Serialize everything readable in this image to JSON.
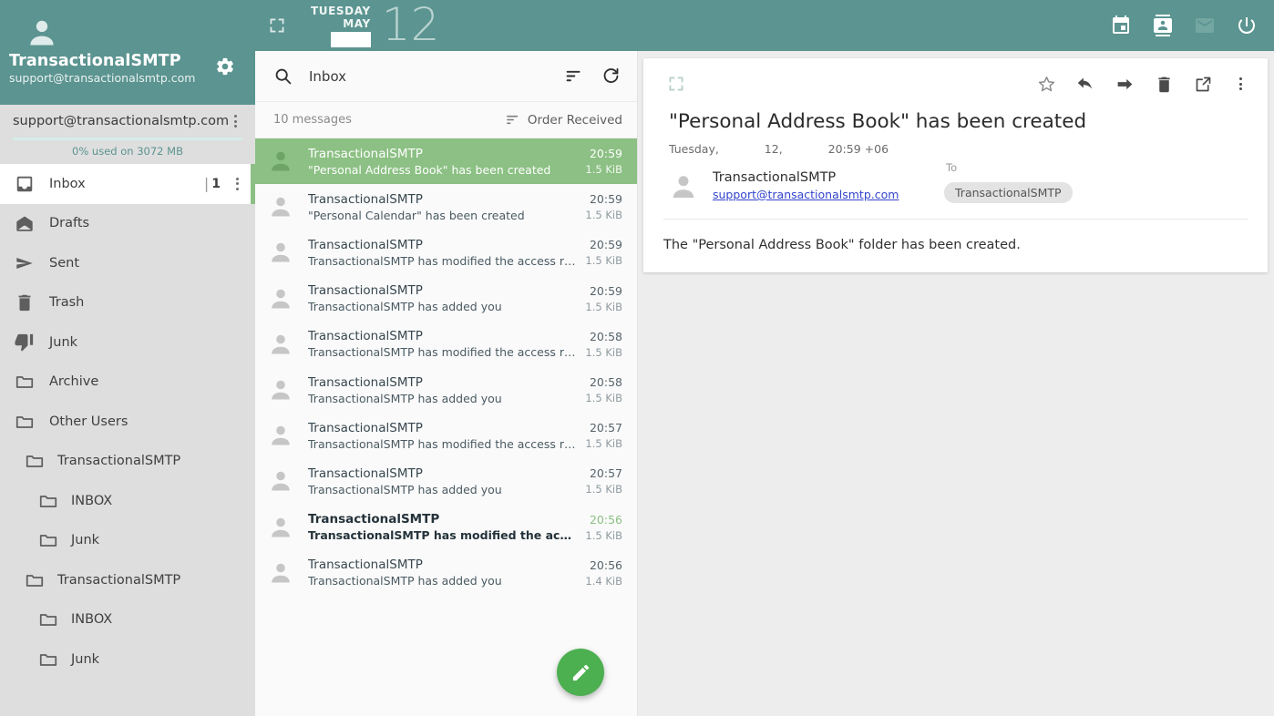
{
  "theme": {
    "teal": "#5b9490",
    "green_accent": "#8cbf84",
    "selected_row": "#8cc084",
    "fab_green": "#4caf50",
    "sidebar_bg": "#dedede",
    "list_bg": "#fafafa",
    "reader_bg": "#ededed"
  },
  "sidebar": {
    "avatar_icon": "person-icon",
    "display_name": "TransactionalSMTP",
    "email": "support@transactionalsmtp.com",
    "settings_icon": "gear-icon",
    "account": {
      "email": "support@transactionalsmtp.com",
      "menu_icon": "kebab-menu-icon",
      "quota_text": "0% used on 3072 MB",
      "quota_percent": 0
    },
    "folders": [
      {
        "label": "Inbox",
        "icon": "inbox-icon",
        "count": "1",
        "selected": true,
        "level": 0,
        "menu_icon": "kebab-menu-icon"
      },
      {
        "label": "Drafts",
        "icon": "draft-envelope-icon",
        "count": "",
        "selected": false,
        "level": 0
      },
      {
        "label": "Sent",
        "icon": "send-arrow-icon",
        "count": "",
        "selected": false,
        "level": 0
      },
      {
        "label": "Trash",
        "icon": "trash-icon",
        "count": "",
        "selected": false,
        "level": 0
      },
      {
        "label": "Junk",
        "icon": "thumb-down-icon",
        "count": "",
        "selected": false,
        "level": 0
      },
      {
        "label": "Archive",
        "icon": "folder-icon",
        "count": "",
        "selected": false,
        "level": 0
      },
      {
        "label": "Other Users",
        "icon": "folder-icon",
        "count": "",
        "selected": false,
        "level": 0
      },
      {
        "label": "TransactionalSMTP",
        "icon": "folder-icon",
        "count": "",
        "selected": false,
        "level": 1
      },
      {
        "label": "INBOX",
        "icon": "folder-icon",
        "count": "",
        "selected": false,
        "level": 2
      },
      {
        "label": "Junk",
        "icon": "folder-icon",
        "count": "",
        "selected": false,
        "level": 2
      },
      {
        "label": "TransactionalSMTP",
        "icon": "folder-icon",
        "count": "",
        "selected": false,
        "level": 1
      },
      {
        "label": "INBOX",
        "icon": "folder-icon",
        "count": "",
        "selected": false,
        "level": 2
      },
      {
        "label": "Junk",
        "icon": "folder-icon",
        "count": "",
        "selected": false,
        "level": 2
      }
    ]
  },
  "topbar": {
    "expand_icon": "fullscreen-icon",
    "weekday": "TUESDAY",
    "month": "MAY",
    "year_redacted": true,
    "day": "12",
    "actions": [
      {
        "name": "calendar-icon",
        "dim": false
      },
      {
        "name": "contacts-icon",
        "dim": false
      },
      {
        "name": "mail-icon",
        "dim": true
      },
      {
        "name": "power-icon",
        "dim": false
      }
    ]
  },
  "list": {
    "search_icon": "search-icon",
    "search_value": "Inbox",
    "search_placeholder": "Search",
    "sort_icon": "sort-icon",
    "refresh_icon": "refresh-icon",
    "message_count": "10 messages",
    "order_icon": "sort-icon",
    "order_label": "Order Received",
    "compose_icon": "pencil-icon",
    "messages": [
      {
        "from": "TransactionalSMTP",
        "subject": "\"Personal Address Book\" has been created",
        "time": "20:59",
        "size": "1.5 KiB",
        "selected": true,
        "unread": false
      },
      {
        "from": "TransactionalSMTP",
        "subject": "\"Personal Calendar\" has been created",
        "time": "20:59",
        "size": "1.5 KiB",
        "selected": false,
        "unread": false
      },
      {
        "from": "TransactionalSMTP",
        "subject": "TransactionalSMTP has modified the access rights",
        "time": "20:59",
        "size": "1.5 KiB",
        "selected": false,
        "unread": false
      },
      {
        "from": "TransactionalSMTP",
        "subject": "TransactionalSMTP has added you",
        "time": "20:59",
        "size": "1.5 KiB",
        "selected": false,
        "unread": false
      },
      {
        "from": "TransactionalSMTP",
        "subject": "TransactionalSMTP has modified the access rights",
        "time": "20:58",
        "size": "1.5 KiB",
        "selected": false,
        "unread": false
      },
      {
        "from": "TransactionalSMTP",
        "subject": "TransactionalSMTP has added you",
        "time": "20:58",
        "size": "1.5 KiB",
        "selected": false,
        "unread": false
      },
      {
        "from": "TransactionalSMTP",
        "subject": "TransactionalSMTP has modified the access rights",
        "time": "20:57",
        "size": "1.5 KiB",
        "selected": false,
        "unread": false
      },
      {
        "from": "TransactionalSMTP",
        "subject": "TransactionalSMTP has added you",
        "time": "20:57",
        "size": "1.5 KiB",
        "selected": false,
        "unread": false
      },
      {
        "from": "TransactionalSMTP",
        "subject": "TransactionalSMTP has modified the access rights",
        "time": "20:56",
        "size": "1.5 KiB",
        "selected": false,
        "unread": true
      },
      {
        "from": "TransactionalSMTP",
        "subject": "TransactionalSMTP has added you",
        "time": "20:56",
        "size": "1.4 KiB",
        "selected": false,
        "unread": false
      }
    ]
  },
  "reader": {
    "toolbar": {
      "expand_icon": "fullscreen-icon",
      "star_icon": "star-icon",
      "reply_icon": "reply-arrow-icon",
      "forward_icon": "forward-arrow-icon",
      "delete_icon": "trash-icon",
      "open_icon": "open-external-icon",
      "more_icon": "kebab-menu-icon"
    },
    "subject": "\"Personal Address Book\" has been created",
    "date_weekday": "Tuesday,",
    "date_day": "12,",
    "date_time": "20:59 +06",
    "sender_avatar_icon": "person-icon",
    "sender_name": "TransactionalSMTP",
    "sender_email": "support@transactionalsmtp.com",
    "to_label": "To",
    "to_chip": "TransactionalSMTP",
    "body": "The \"Personal Address Book\" folder has been created."
  }
}
